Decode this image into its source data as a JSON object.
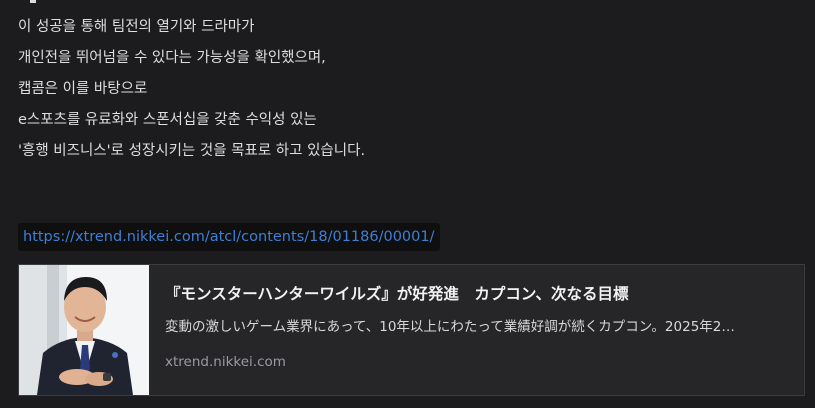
{
  "post": {
    "lines": [
      "이 성공을 통해 팀전의 열기와 드라마가",
      "개인전을 뛰어넘을 수 있다는 가능성을 확인했으며,",
      "캡콤은 이를 바탕으로",
      "e스포츠를 유료화와 스폰서십을 갖춘 수익성 있는",
      "'흥행 비즈니스'로 성장시키는 것을 목표로 하고 있습니다."
    ],
    "url": "https://xtrend.nikkei.com/atcl/contents/18/01186/00001/"
  },
  "link_preview": {
    "title": "『モンスターハンターワイルズ』が好発進　カプコン、次なる目標",
    "description": "変動の激しいゲーム業界にあって、10年以上にわたって業績好調が続くカプコン。2025年2…",
    "domain": "xtrend.nikkei.com",
    "thumbnail": "portrait-photo"
  },
  "colors": {
    "background": "#1c1c1e",
    "link": "#3f7fd6",
    "card_background": "#262628"
  }
}
